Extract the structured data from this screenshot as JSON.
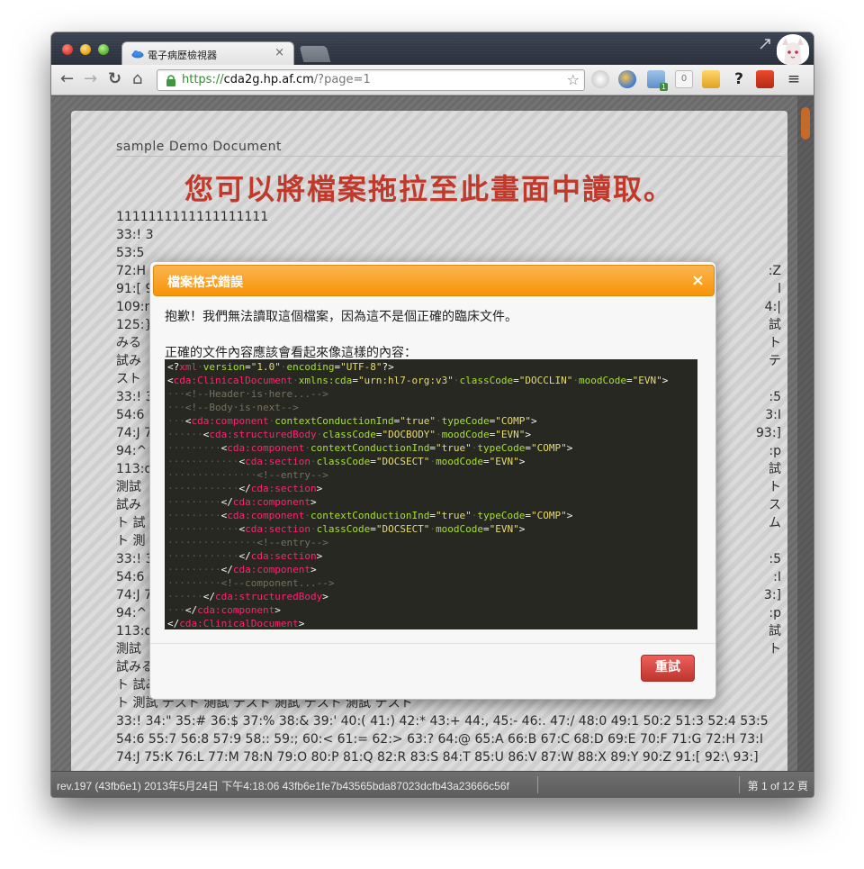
{
  "browser": {
    "tab_title": "電子病歷檢視器",
    "tab_close": "×",
    "url_scheme": "https://",
    "url_host": "cda2g.hp.af.cm",
    "url_path": "/?page=1",
    "extension_badge_count": "0",
    "ext_badge_1": "1"
  },
  "page": {
    "document_name": "sample Demo Document",
    "drop_hint": "您可以將檔案拖拉至此畫面中讀取。",
    "lines": [
      "1111111111111111111",
      "33:! 3",
      "53:5",
      "72:H",
      "91:[ 9",
      "109:r",
      "125:}",
      "みる",
      "試み",
      "スト",
      "33:! 3",
      "54:6",
      "74:J 7",
      "94:^",
      "113:q",
      "測試",
      "試み",
      "ト 試",
      "ト 測",
      "33:! 3",
      "54:6",
      "74:J 7",
      "94:^",
      "113:q",
      "測試",
      "試みる 測試 テスト 試みる 測試 テスト 試みる 測試 テスト 試みる 測試 テスト 試みる 測試 テスト",
      "ト 試みる 測試 テスト 試みる 測試 テスト 測試 テスト 測試 テスト 測試 テスト 測試 テスト 測試 テス",
      "ト 測試 テスト 測試 テスト 測試 テスト 測試 テスト",
      "33:! 34:\" 35:# 36:$ 37:% 38:& 39:' 40:( 41:) 42:* 43:+ 44:, 45:- 46:. 47:/ 48:0 49:1 50:2 51:3 52:4 53:5",
      "54:6 55:7 56:8 57:9 58:: 59:; 60:< 61:= 62:> 63:? 64:@ 65:A 66:B 67:C 68:D 69:E 70:F 71:G 72:H 73:I",
      "74:J 75:K 76:L 77:M 78:N 79:O 80:P 81:Q 82:R 83:S 84:T 85:U 86:V 87:W 88:X 89:Y 90:Z 91:[ 92:\\ 93:]"
    ],
    "right_fragments": [
      {
        "row": 3,
        "text": ":Z"
      },
      {
        "row": 4,
        "text": "l"
      },
      {
        "row": 5,
        "text": "4:|"
      },
      {
        "row": 6,
        "text": "試"
      },
      {
        "row": 7,
        "text": "ト"
      },
      {
        "row": 8,
        "text": "テ"
      },
      {
        "row": 10,
        "text": ":5"
      },
      {
        "row": 11,
        "text": "3:I"
      },
      {
        "row": 12,
        "text": "93:]"
      },
      {
        "row": 13,
        "text": ":p"
      },
      {
        "row": 14,
        "text": "試"
      },
      {
        "row": 15,
        "text": "ト"
      },
      {
        "row": 16,
        "text": "ス"
      },
      {
        "row": 17,
        "text": "ム"
      },
      {
        "row": 19,
        "text": ":5"
      },
      {
        "row": 20,
        "text": ":I"
      },
      {
        "row": 21,
        "text": "3:]"
      },
      {
        "row": 22,
        "text": ":p"
      },
      {
        "row": 23,
        "text": "試"
      },
      {
        "row": 24,
        "text": "ト"
      }
    ]
  },
  "modal": {
    "title": "檔案格式錯誤",
    "close": "×",
    "message": "抱歉！我們無法讀取這個檔案，因為這不是個正確的臨床文件。",
    "hint": "正確的文件內容應該會看起來像這樣的內容：",
    "retry_label": "重試",
    "code_lines": [
      [
        [
          "pi",
          "<?"
        ],
        [
          "tag",
          "xml"
        ],
        [
          "dot",
          "·"
        ],
        [
          "attr",
          "version"
        ],
        [
          "pi",
          "="
        ],
        [
          "val",
          "\"1.0\""
        ],
        [
          "dot",
          "·"
        ],
        [
          "attr",
          "encoding"
        ],
        [
          "pi",
          "="
        ],
        [
          "val",
          "\"UTF-8\""
        ],
        [
          "pi",
          "?>"
        ]
      ],
      [
        [
          "pi",
          "<"
        ],
        [
          "tag",
          "cda:ClinicalDocument"
        ],
        [
          "dot",
          "·"
        ],
        [
          "attr",
          "xmlns:cda"
        ],
        [
          "pi",
          "="
        ],
        [
          "val",
          "\"urn:hl7-org:v3\""
        ],
        [
          "dot",
          "·"
        ],
        [
          "attr",
          "classCode"
        ],
        [
          "pi",
          "="
        ],
        [
          "val",
          "\"DOCCLIN\""
        ],
        [
          "dot",
          "·"
        ],
        [
          "attr",
          "moodCode"
        ],
        [
          "pi",
          "="
        ],
        [
          "val",
          "\"EVN\""
        ],
        [
          "pi",
          ">"
        ]
      ],
      [
        [
          "dot",
          "···"
        ],
        [
          "com",
          "<!--Header·is·here...-->"
        ]
      ],
      [
        [
          "dot",
          "···"
        ],
        [
          "com",
          "<!--Body·is·next-->"
        ]
      ],
      [
        [
          "dot",
          "···"
        ],
        [
          "pi",
          "<"
        ],
        [
          "tag",
          "cda:component"
        ],
        [
          "dot",
          "·"
        ],
        [
          "attr",
          "contextConductionInd"
        ],
        [
          "pi",
          "="
        ],
        [
          "val",
          "\"true\""
        ],
        [
          "dot",
          "·"
        ],
        [
          "attr",
          "typeCode"
        ],
        [
          "pi",
          "="
        ],
        [
          "val",
          "\"COMP\""
        ],
        [
          "pi",
          ">"
        ]
      ],
      [
        [
          "dot",
          "······"
        ],
        [
          "pi",
          "<"
        ],
        [
          "tag",
          "cda:structuredBody"
        ],
        [
          "dot",
          "·"
        ],
        [
          "attr",
          "classCode"
        ],
        [
          "pi",
          "="
        ],
        [
          "val",
          "\"DOCBODY\""
        ],
        [
          "dot",
          "·"
        ],
        [
          "attr",
          "moodCode"
        ],
        [
          "pi",
          "="
        ],
        [
          "val",
          "\"EVN\""
        ],
        [
          "pi",
          ">"
        ]
      ],
      [
        [
          "dot",
          "·········"
        ],
        [
          "pi",
          "<"
        ],
        [
          "tag",
          "cda:component"
        ],
        [
          "dot",
          "·"
        ],
        [
          "attr",
          "contextConductionInd"
        ],
        [
          "pi",
          "="
        ],
        [
          "val",
          "\"true\""
        ],
        [
          "dot",
          "·"
        ],
        [
          "attr",
          "typeCode"
        ],
        [
          "pi",
          "="
        ],
        [
          "val",
          "\"COMP\""
        ],
        [
          "pi",
          ">"
        ]
      ],
      [
        [
          "dot",
          "············"
        ],
        [
          "pi",
          "<"
        ],
        [
          "tag",
          "cda:section"
        ],
        [
          "dot",
          "·"
        ],
        [
          "attr",
          "classCode"
        ],
        [
          "pi",
          "="
        ],
        [
          "val",
          "\"DOCSECT\""
        ],
        [
          "dot",
          "·"
        ],
        [
          "attr",
          "moodCode"
        ],
        [
          "pi",
          "="
        ],
        [
          "val",
          "\"EVN\""
        ],
        [
          "pi",
          ">"
        ]
      ],
      [
        [
          "dot",
          "···············"
        ],
        [
          "com",
          "<!--entry-->"
        ]
      ],
      [
        [
          "dot",
          "············"
        ],
        [
          "pi",
          "</"
        ],
        [
          "tag",
          "cda:section"
        ],
        [
          "pi",
          ">"
        ]
      ],
      [
        [
          "dot",
          "·········"
        ],
        [
          "pi",
          "</"
        ],
        [
          "tag",
          "cda:component"
        ],
        [
          "pi",
          ">"
        ]
      ],
      [
        [
          "dot",
          "·········"
        ],
        [
          "pi",
          "<"
        ],
        [
          "tag",
          "cda:component"
        ],
        [
          "dot",
          "·"
        ],
        [
          "attr",
          "contextConductionInd"
        ],
        [
          "pi",
          "="
        ],
        [
          "val",
          "\"true\""
        ],
        [
          "dot",
          "·"
        ],
        [
          "attr",
          "typeCode"
        ],
        [
          "pi",
          "="
        ],
        [
          "val",
          "\"COMP\""
        ],
        [
          "pi",
          ">"
        ]
      ],
      [
        [
          "dot",
          "············"
        ],
        [
          "pi",
          "<"
        ],
        [
          "tag",
          "cda:section"
        ],
        [
          "dot",
          "·"
        ],
        [
          "attr",
          "classCode"
        ],
        [
          "pi",
          "="
        ],
        [
          "val",
          "\"DOCSECT\""
        ],
        [
          "dot",
          "·"
        ],
        [
          "attr",
          "moodCode"
        ],
        [
          "pi",
          "="
        ],
        [
          "val",
          "\"EVN\""
        ],
        [
          "pi",
          ">"
        ]
      ],
      [
        [
          "dot",
          "···············"
        ],
        [
          "com",
          "<!--entry-->"
        ]
      ],
      [
        [
          "dot",
          "············"
        ],
        [
          "pi",
          "</"
        ],
        [
          "tag",
          "cda:section"
        ],
        [
          "pi",
          ">"
        ]
      ],
      [
        [
          "dot",
          "·········"
        ],
        [
          "pi",
          "</"
        ],
        [
          "tag",
          "cda:component"
        ],
        [
          "pi",
          ">"
        ]
      ],
      [
        [
          "dot",
          "·········"
        ],
        [
          "com",
          "<!--component...-->"
        ]
      ],
      [
        [
          "dot",
          "······"
        ],
        [
          "pi",
          "</"
        ],
        [
          "tag",
          "cda:structuredBody"
        ],
        [
          "pi",
          ">"
        ]
      ],
      [
        [
          "dot",
          "···"
        ],
        [
          "pi",
          "</"
        ],
        [
          "tag",
          "cda:component"
        ],
        [
          "pi",
          ">"
        ]
      ],
      [
        [
          "pi",
          "</"
        ],
        [
          "tag",
          "cda:ClinicalDocument"
        ],
        [
          "pi",
          ">"
        ]
      ]
    ]
  },
  "statusbar": {
    "revision": "rev.197 (43fb6e1) 2013年5月24日 下午4:18:06 43fb6e1fe7b43565bda87023dcfb43a23666c56f",
    "page_info": "第 1 of 12 頁"
  },
  "colors": {
    "accent_orange": "#f89406",
    "danger_red": "#bd362f",
    "hint_red": "#c0392b",
    "code_bg": "#272822"
  }
}
